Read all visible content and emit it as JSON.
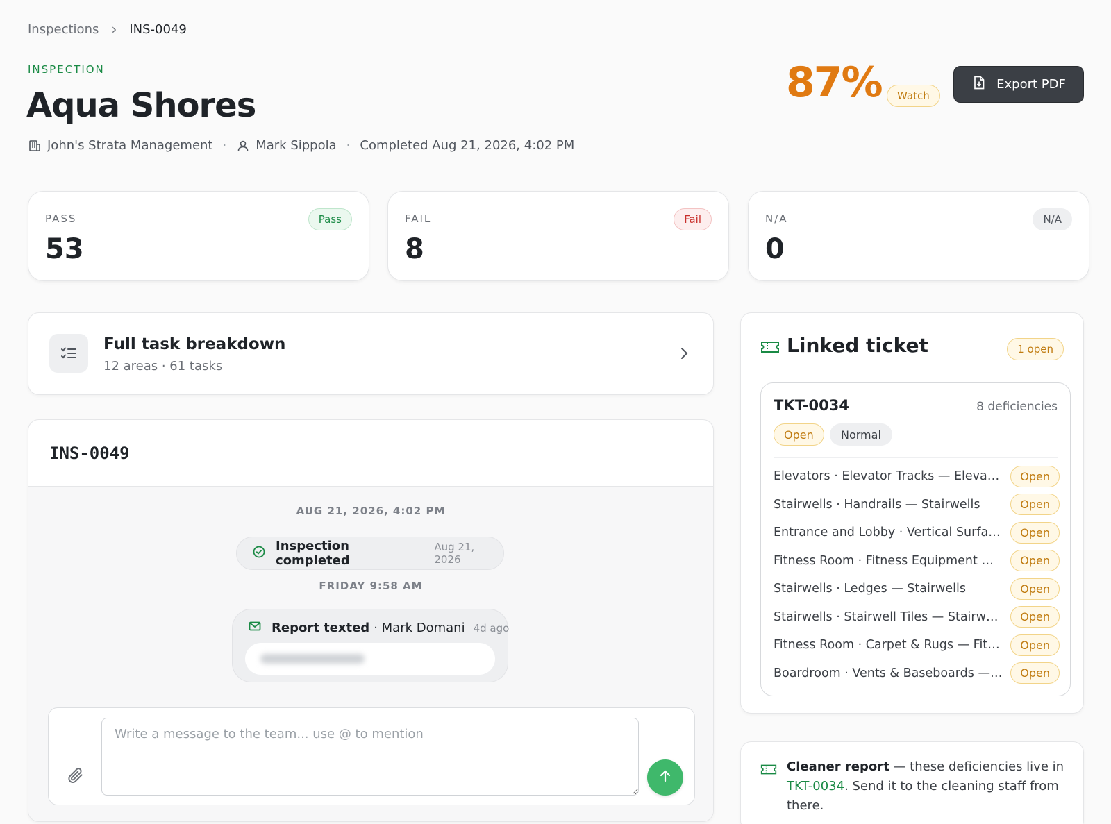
{
  "breadcrumb": {
    "parent": "Inspections",
    "separator": "›",
    "current": "INS-0049"
  },
  "header": {
    "eyebrow": "INSPECTION",
    "title": "Aqua Shores",
    "company": "John's Strata Management",
    "inspector": "Mark Sippola",
    "completed": "Completed Aug 21, 2026, 4:02 PM",
    "separator": "·"
  },
  "score": {
    "value": "87%",
    "status": "Watch"
  },
  "actions": {
    "export_label": "Export PDF"
  },
  "stats": [
    {
      "label": "PASS",
      "value": "53",
      "badge": "Pass"
    },
    {
      "label": "FAIL",
      "value": "8",
      "badge": "Fail"
    },
    {
      "label": "N/A",
      "value": "0",
      "badge": "N/A"
    }
  ],
  "breakdown": {
    "title": "Full task breakdown",
    "subtitle": "12 areas · 61 tasks"
  },
  "thread": {
    "title": "INS-0049",
    "day1": "AUG 21, 2026, 4:02 PM",
    "event": {
      "text": "Inspection completed",
      "date": "Aug 21, 2026"
    },
    "day2": "FRIDAY 9:58 AM",
    "report": {
      "text": "Report texted",
      "by": "· Mark Domani",
      "ago": "4d ago"
    },
    "composer_placeholder": "Write a message to the team... use @ to mention"
  },
  "linked_ticket": {
    "title": "Linked ticket",
    "open_count": "1 open",
    "ticket": {
      "id": "TKT-0034",
      "deficiency_count": "8 deficiencies",
      "status": "Open",
      "priority": "Normal",
      "deficiencies": [
        {
          "label": "Elevators · Elevator Tracks — Elevators",
          "status": "Open"
        },
        {
          "label": "Stairwells · Handrails — Stairwells",
          "status": "Open"
        },
        {
          "label": "Entrance and Lobby · Vertical Surfac...",
          "status": "Open"
        },
        {
          "label": "Fitness Room · Fitness Equipment —...",
          "status": "Open"
        },
        {
          "label": "Stairwells · Ledges — Stairwells",
          "status": "Open"
        },
        {
          "label": "Stairwells · Stairwell Tiles — Stairwells",
          "status": "Open"
        },
        {
          "label": "Fitness Room · Carpet & Rugs — Fitn...",
          "status": "Open"
        },
        {
          "label": "Boardroom · Vents & Baseboards — ...",
          "status": "Open"
        }
      ]
    }
  },
  "cleaner": {
    "bold": "Cleaner report",
    "text1": " — these deficiencies live in ",
    "link": "TKT-0034",
    "text2": ". Send it to the cleaning staff from there."
  },
  "colors": {
    "accent_green": "#1a8a45",
    "score_orange": "#e07a12",
    "warning": "#c07b10",
    "danger": "#c9302c",
    "send": "#3fb86b"
  },
  "icons": [
    "building-icon",
    "user-icon",
    "file-download-icon",
    "checklist-icon",
    "chevron-right-icon",
    "ticket-icon",
    "check-circle-icon",
    "mail-icon",
    "paperclip-icon",
    "arrow-up-icon"
  ]
}
